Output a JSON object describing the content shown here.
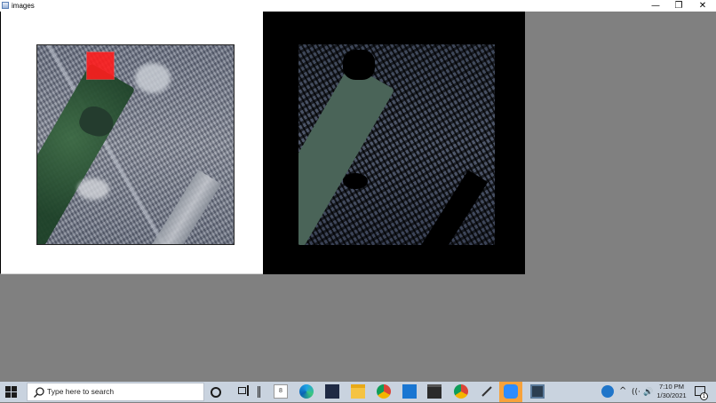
{
  "window": {
    "title": "images",
    "controls": {
      "minimize": "—",
      "maximize": "❐",
      "close": "✕"
    }
  },
  "taskbar": {
    "search_placeholder": "Type here to search",
    "sticky_count": "8",
    "tray": {
      "chevron": "^",
      "wifi": "((·",
      "volume": "🔊"
    },
    "clock": {
      "time": "7:10 PM",
      "date": "1/30/2021"
    },
    "notification_count": "1"
  }
}
